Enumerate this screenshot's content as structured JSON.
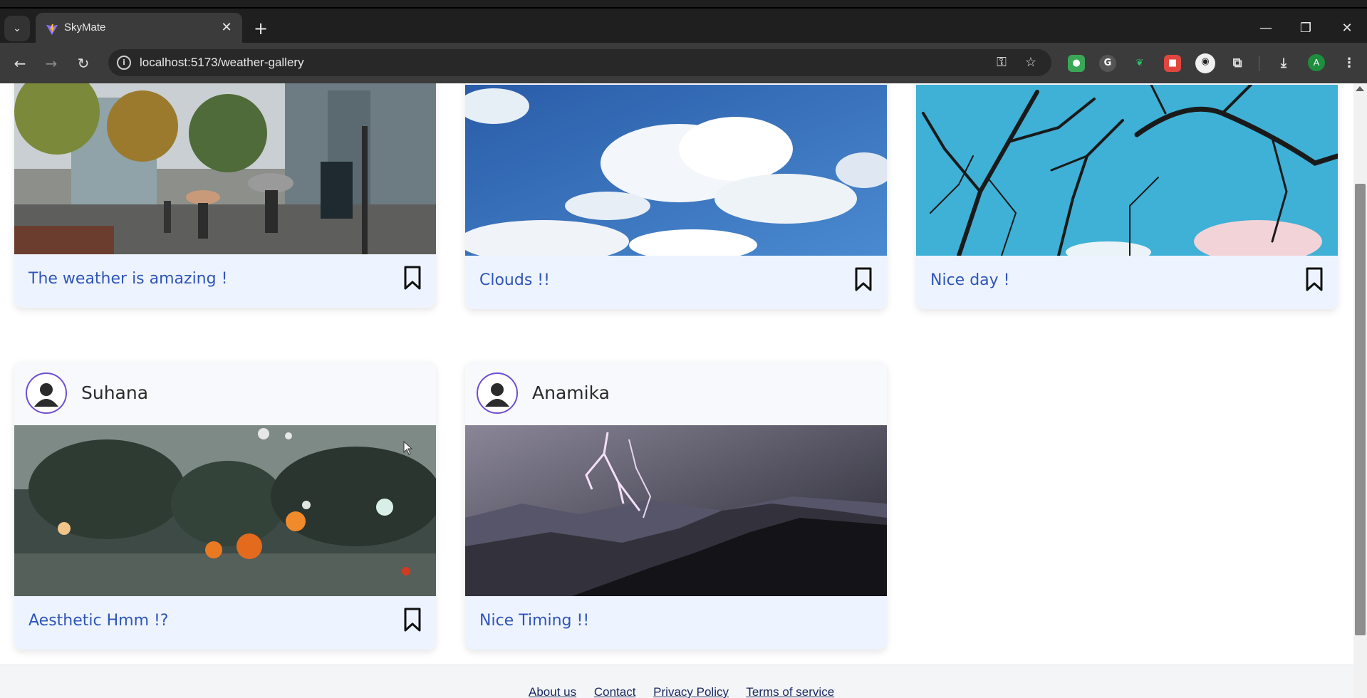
{
  "browser": {
    "tab_title": "SkyMate",
    "url": "localhost:5173/weather-gallery",
    "profile_initial": "A",
    "new_tab_symbol": "+",
    "close_symbol": "✕"
  },
  "gallery": {
    "cards": [
      {
        "user": "",
        "caption": "The weather is amazing !",
        "image": "rainy-city-street-umbrellas",
        "bookmark": true
      },
      {
        "user": "",
        "caption": "Clouds !!",
        "image": "blue-sky-white-clouds",
        "bookmark": true
      },
      {
        "user": "",
        "caption": "Nice day !",
        "image": "bare-tree-branches-blue-sky",
        "bookmark": true
      },
      {
        "user": "Suhana",
        "caption": "Aesthetic Hmm !?",
        "image": "rain-drops-on-window-night-lights",
        "bookmark": true
      },
      {
        "user": "Anamika",
        "caption": "Nice Timing !!",
        "image": "lightning-over-canyon",
        "bookmark": false
      }
    ]
  },
  "footer": {
    "links": [
      "About us",
      "Contact",
      "Privacy Policy",
      "Terms of service"
    ]
  },
  "colors": {
    "caption": "#2f55b8",
    "avatar_ring": "#6d4ed0",
    "card_footer": "#eef4ff"
  }
}
